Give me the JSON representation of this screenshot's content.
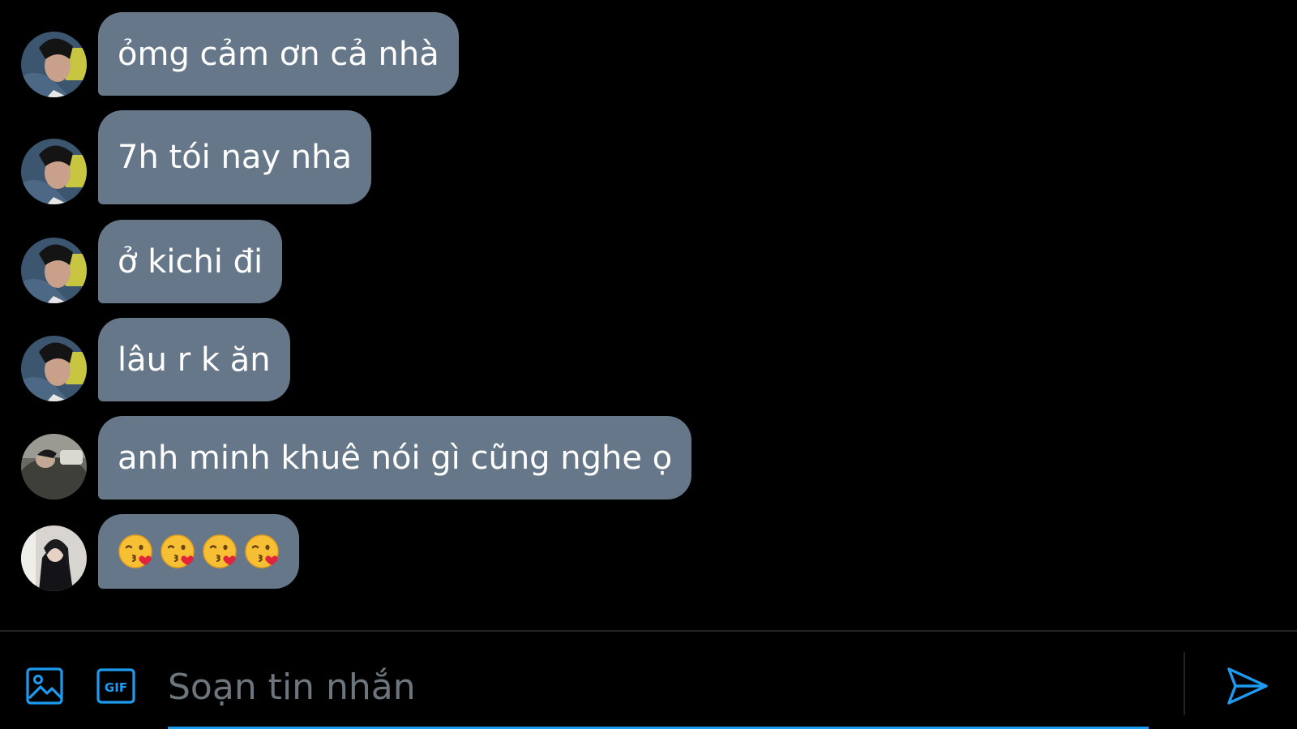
{
  "messages": [
    {
      "text": "ỏmg cảm ơn cả nhà",
      "avatar": "avatar-1"
    },
    {
      "text": "7h tói nay nha",
      "avatar": "avatar-1"
    },
    {
      "text": "ở kichi đi",
      "avatar": "avatar-1"
    },
    {
      "text": "lâu r k ăn",
      "avatar": "avatar-1"
    },
    {
      "text": "anh minh khuê nói gì cũng nghe ọ",
      "avatar": "avatar-2"
    },
    {
      "text": "",
      "emojis": [
        "kissing-face-with-heart",
        "kissing-face-with-heart",
        "kissing-face-with-heart",
        "kissing-face-with-heart"
      ],
      "avatar": "avatar-3"
    }
  ],
  "composer": {
    "placeholder": "Soạn tin nhắn",
    "value": "",
    "icons": [
      "image-icon",
      "gif-icon",
      "send-icon"
    ]
  },
  "colors": {
    "background": "#000000",
    "bubble": "#66778a",
    "accent": "#1d9bf0",
    "placeholder": "#6e767d",
    "divider": "#1f2326"
  }
}
